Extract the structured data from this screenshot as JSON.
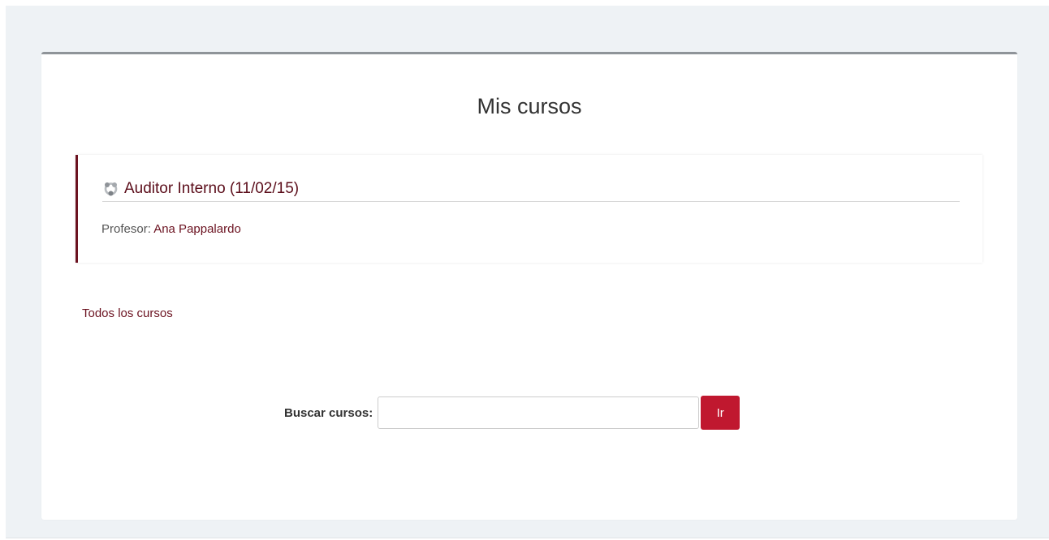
{
  "page": {
    "title": "Mis cursos"
  },
  "course": {
    "name": "Auditor Interno (11/02/15)",
    "icon": "course-icon",
    "teacher_label": "Profesor: ",
    "teacher_name": "Ana Pappalardo"
  },
  "links": {
    "all_courses": "Todos los cursos"
  },
  "search": {
    "label": "Buscar cursos:",
    "value": "",
    "placeholder": "",
    "button_label": "Ir"
  },
  "colors": {
    "accent": "#6b1220",
    "button": "#c0182f",
    "background": "#eef2f5"
  }
}
